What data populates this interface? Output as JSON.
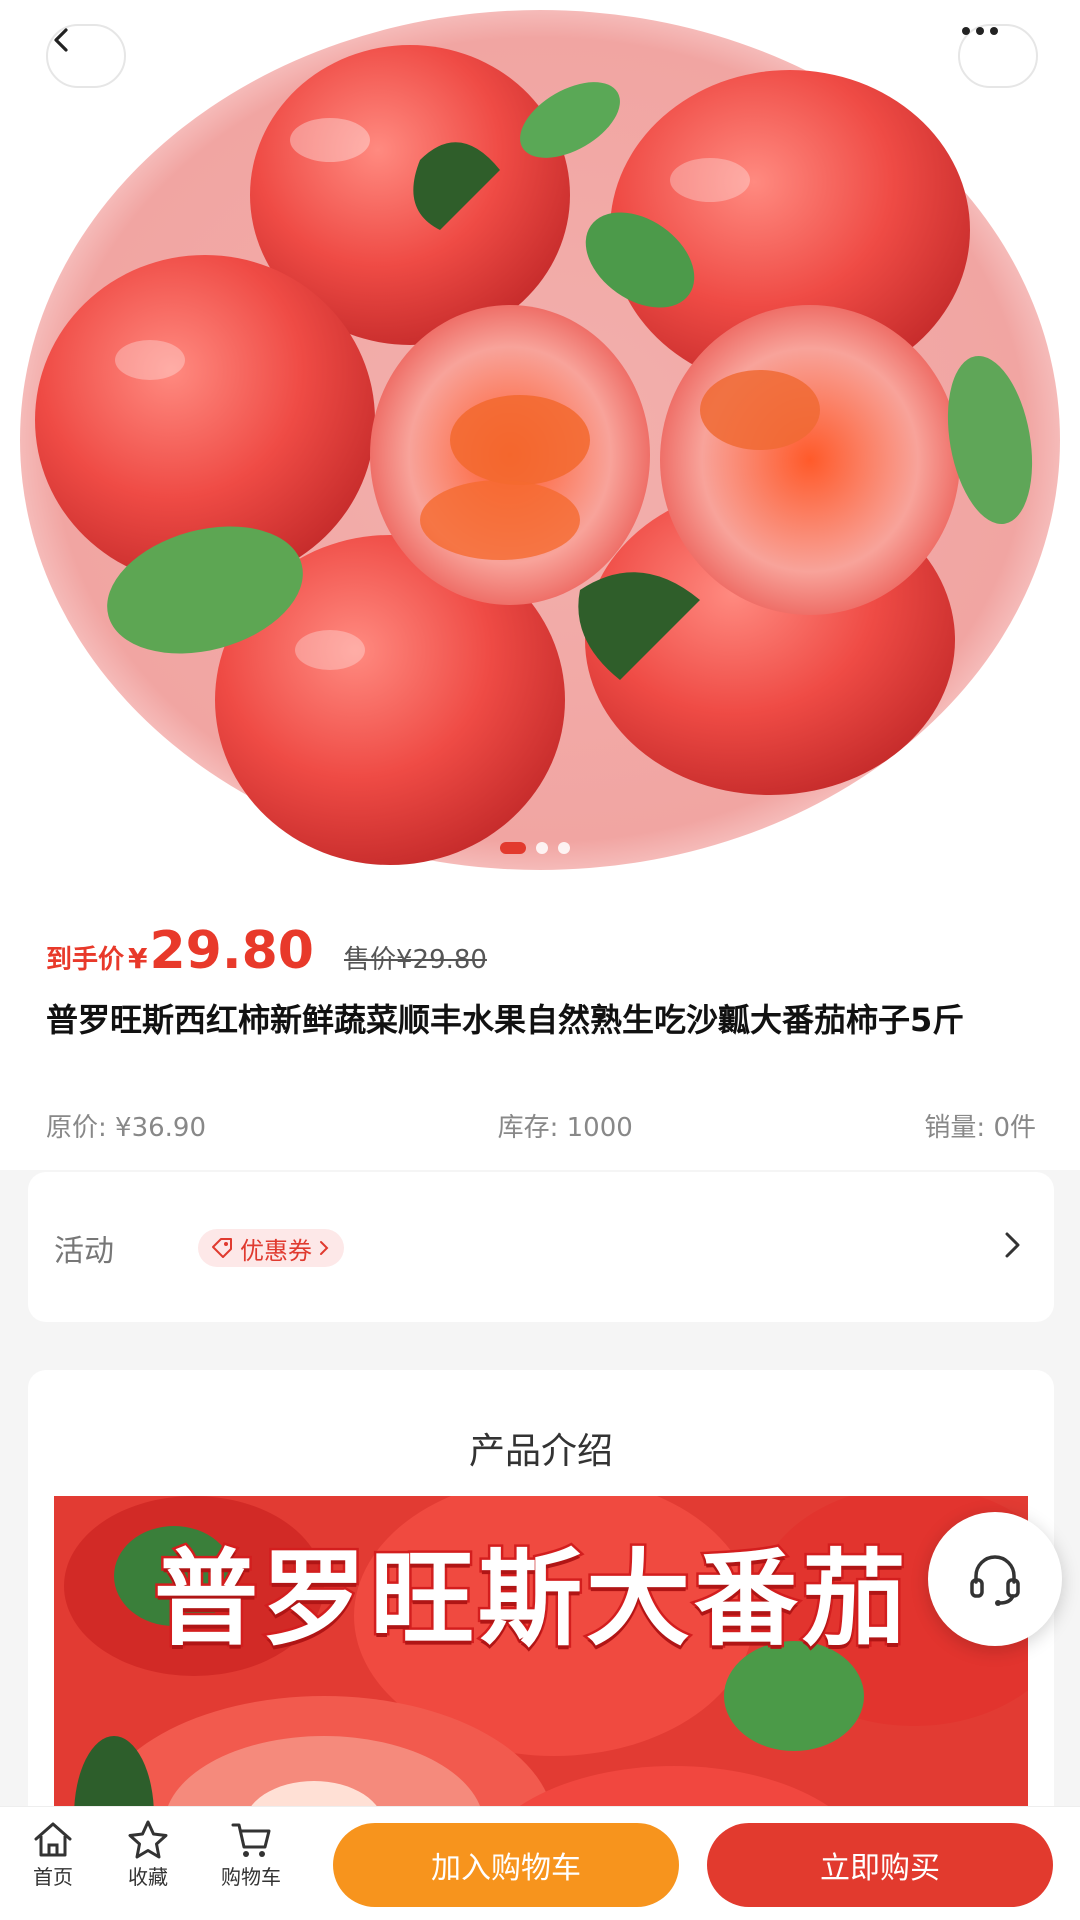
{
  "hero": {
    "image_alt": "tomatoes in pink bowl",
    "carousel": {
      "count": 3,
      "active": 0
    }
  },
  "product": {
    "price_label": "到手价",
    "currency": "¥",
    "price": "29.80",
    "sale_price": "售价¥29.80",
    "title": "普罗旺斯西红柿新鲜蔬菜顺丰水果自然熟生吃沙瓤大番茄柿子5斤",
    "original_price": "原价: ¥36.90",
    "stock": "库存: 1000",
    "sales": "销量: 0件"
  },
  "activity": {
    "label": "活动",
    "coupon_label": "优惠券"
  },
  "intro": {
    "title": "产品介绍",
    "banner_text": "普罗旺斯大番茄"
  },
  "bottom_nav": {
    "home": "首页",
    "favorite": "收藏",
    "cart": "购物车",
    "add_to_cart": "加入购物车",
    "buy_now": "立即购买"
  },
  "colors": {
    "accent_red": "#e23a2e",
    "accent_orange": "#f7941d",
    "coupon_bg": "#fde8e8"
  },
  "icons": [
    "back-icon",
    "more-icon",
    "coupon-tag-icon",
    "chevron-right-icon",
    "headset-icon",
    "home-icon",
    "star-icon",
    "cart-icon"
  ]
}
